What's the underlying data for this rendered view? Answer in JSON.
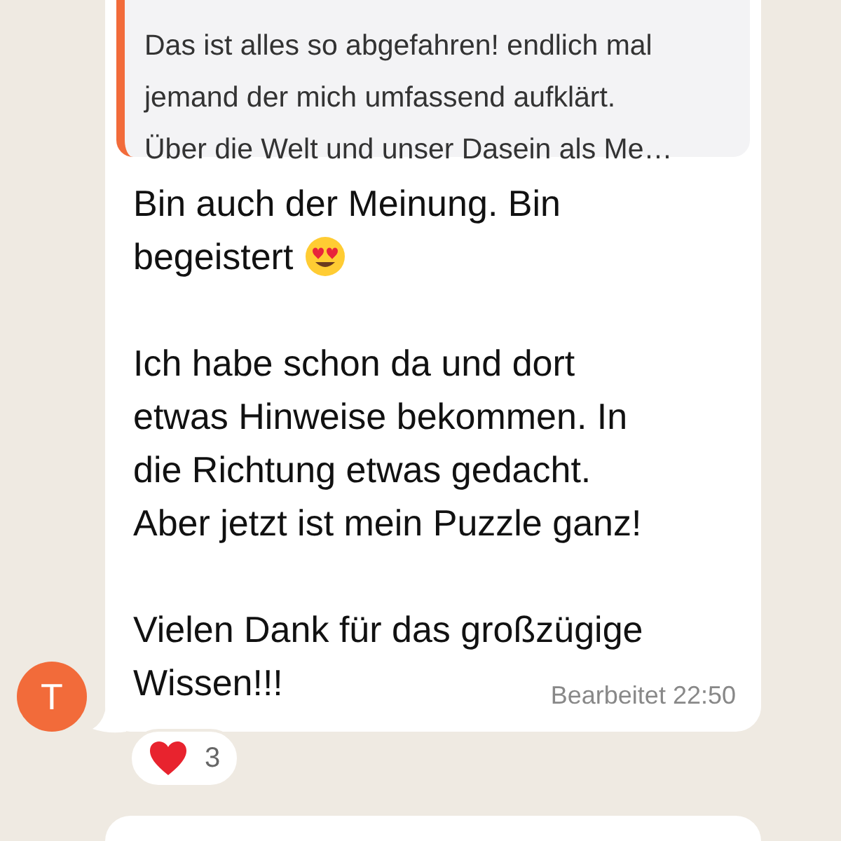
{
  "quoted_message": {
    "lines": [
      "Das ist alles so abgefahren! endlich mal",
      "jemand der mich umfassend aufklärt.",
      "Über die Welt und unser Dasein als Me…"
    ]
  },
  "message": {
    "avatar": "T",
    "paragraphs": [
      {
        "lines": [
          "Bin auch der Meinung. Bin",
          "begeistert"
        ]
      },
      {
        "lines": [
          "Ich habe schon da und dort",
          "etwas Hinweise bekommen. In",
          "die Richtung etwas gedacht.",
          "Aber jetzt ist mein Puzzle ganz!"
        ]
      },
      {
        "lines": [
          "Vielen Dank für das großzügige",
          "Wissen!!!"
        ]
      }
    ],
    "meta": "Bearbeitet 22:50",
    "reaction": {
      "count": "3"
    }
  }
}
